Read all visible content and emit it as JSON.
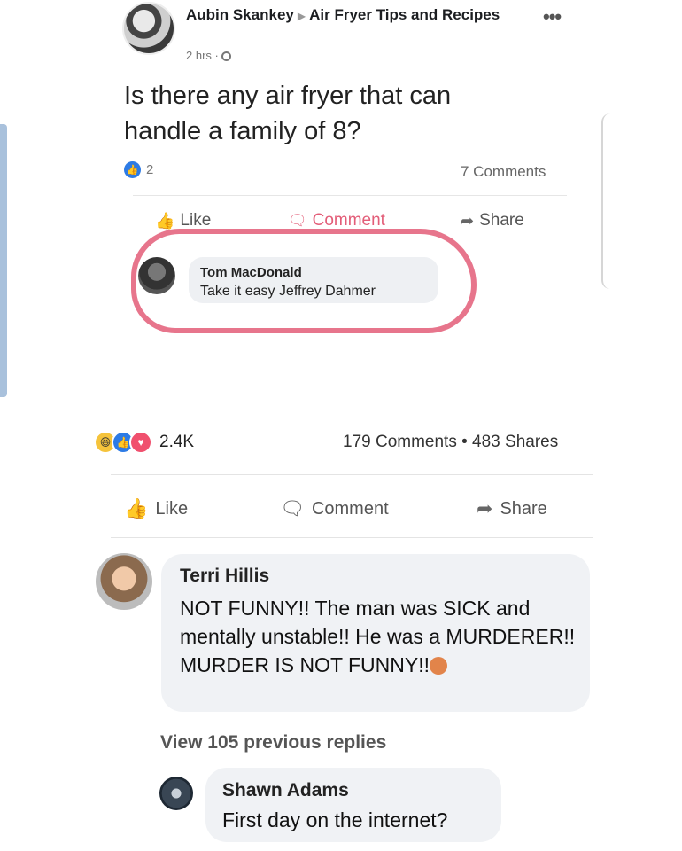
{
  "inner_post": {
    "author": "Aubin Skankey",
    "group": "Air Fryer Tips and Recipes",
    "time": "2 hrs ·",
    "text": "Is there any air fryer that can handle a family of 8?",
    "like_count": "2",
    "comments_count": "7 Comments",
    "actions": {
      "like": "Like",
      "comment": "Comment",
      "share": "Share"
    },
    "comment": {
      "author": "Tom MacDonald",
      "text": "Take it easy Jeffrey Dahmer"
    }
  },
  "outer_post": {
    "reaction_count": "2.4K",
    "comments_shares": "179 Comments • 483 Shares",
    "actions": {
      "like": "Like",
      "comment": "Comment",
      "share": "Share"
    }
  },
  "comments": [
    {
      "author": "Terri Hillis",
      "text": "NOT FUNNY!! The man was SICK and mentally unstable!! He was a MURDERER!! MURDER IS NOT FUNNY!!"
    }
  ],
  "view_replies": "View 105 previous replies",
  "reply": {
    "author": "Shawn Adams",
    "text": "First day on the internet?"
  },
  "colors": {
    "like_blue": "#2d7be5",
    "highlight_ring": "#e35d78",
    "bubble": "#f0f2f5"
  }
}
